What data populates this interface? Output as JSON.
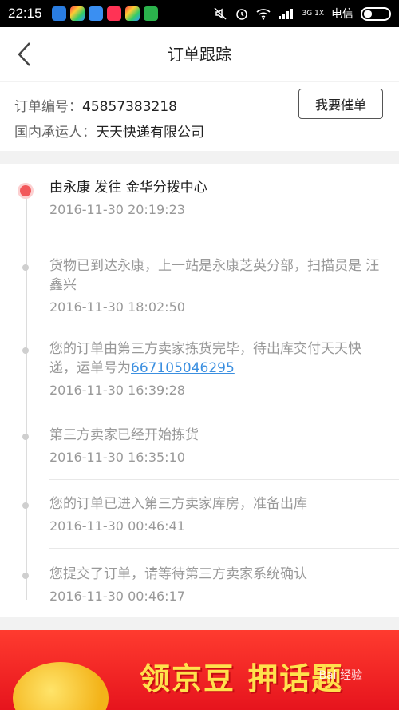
{
  "status_bar": {
    "time": "22:15",
    "network": "3G 1X",
    "carrier": "电信"
  },
  "header": {
    "title": "订单跟踪"
  },
  "order": {
    "number_label": "订单编号：",
    "number_value": "45857383218",
    "carrier_label": "国内承运人：",
    "carrier_value": "天天快递有限公司",
    "urge_label": "我要催单"
  },
  "tracking": [
    {
      "text": "由永康 发往 金华分拨中心",
      "time": "2016-11-30 20:19:23",
      "current": true
    },
    {
      "text": "货物已到达永康，上一站是永康芝英分部，扫描员是 汪鑫兴",
      "time": "2016-11-30 18:02:50"
    },
    {
      "text_before": "您的订单由第三方卖家拣货完毕，待出库交付天天快递，运单号为",
      "link": "667105046295",
      "time": "2016-11-30 16:39:28"
    },
    {
      "text": "第三方卖家已经开始拣货",
      "time": "2016-11-30 16:35:10"
    },
    {
      "text": "您的订单已进入第三方卖家库房，准备出库",
      "time": "2016-11-30 00:46:41"
    },
    {
      "text": "您提交了订单，请等待第三方卖家系统确认",
      "time": "2016-11-30 00:46:17"
    }
  ],
  "banner": {
    "headline": "领京豆 押话题",
    "watermark": "Bai 经验"
  },
  "colors": {
    "accent_dot": "#f2585b",
    "link": "#3b8fe0",
    "banner_red": "#e6141d"
  }
}
